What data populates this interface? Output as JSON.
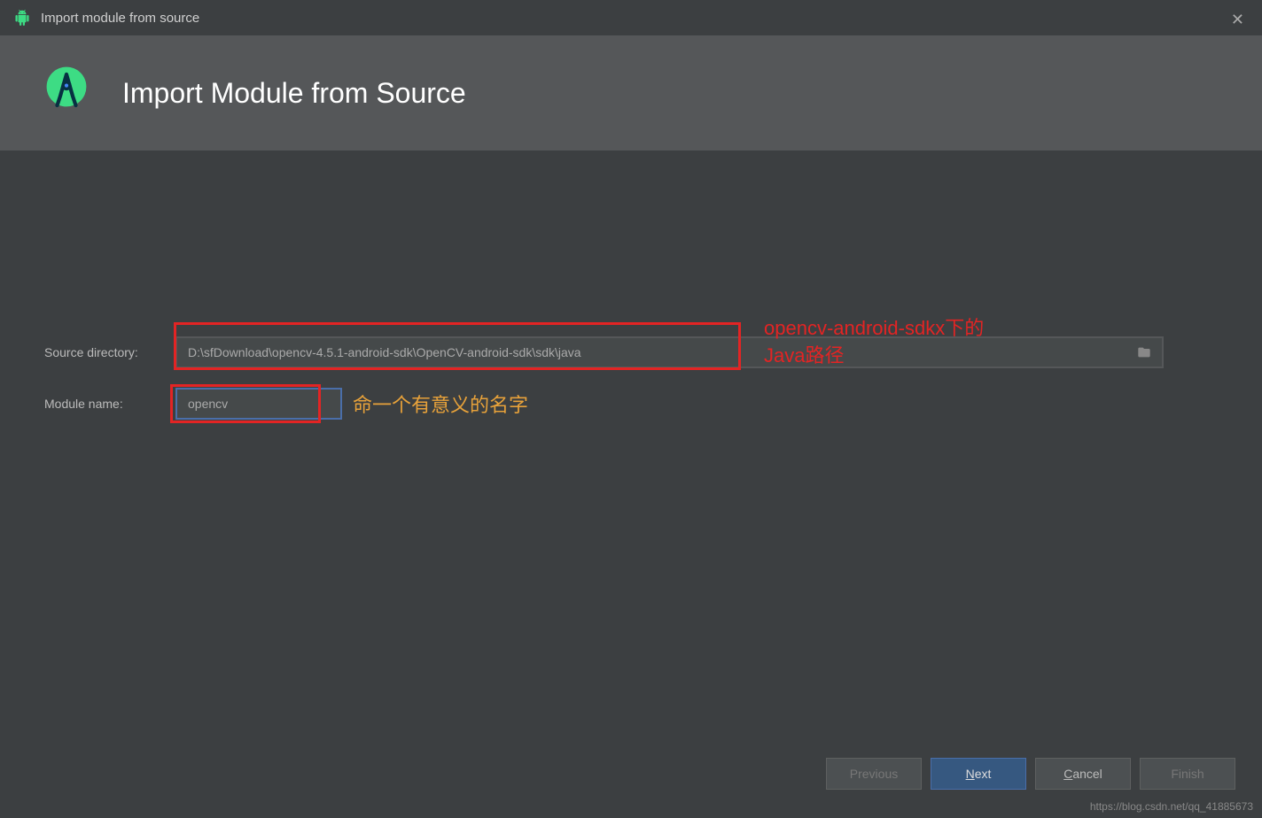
{
  "titleBar": {
    "text": "Import module from source"
  },
  "banner": {
    "title": "Import Module from Source"
  },
  "form": {
    "sourceLabel": "Source directory:",
    "sourceValue": "D:\\sfDownload\\opencv-4.5.1-android-sdk\\OpenCV-android-sdk\\sdk\\java",
    "moduleLabel": "Module name:",
    "moduleValue": "opencv"
  },
  "annotations": {
    "redLine1": "opencv-android-sdkx下的",
    "redLine2": "Java路径",
    "orange": "命一个有意义的名字"
  },
  "footer": {
    "previous": "Previous",
    "next": "Next",
    "cancel": "Cancel",
    "finish": "Finish"
  },
  "watermark": "https://blog.csdn.net/qq_41885673"
}
